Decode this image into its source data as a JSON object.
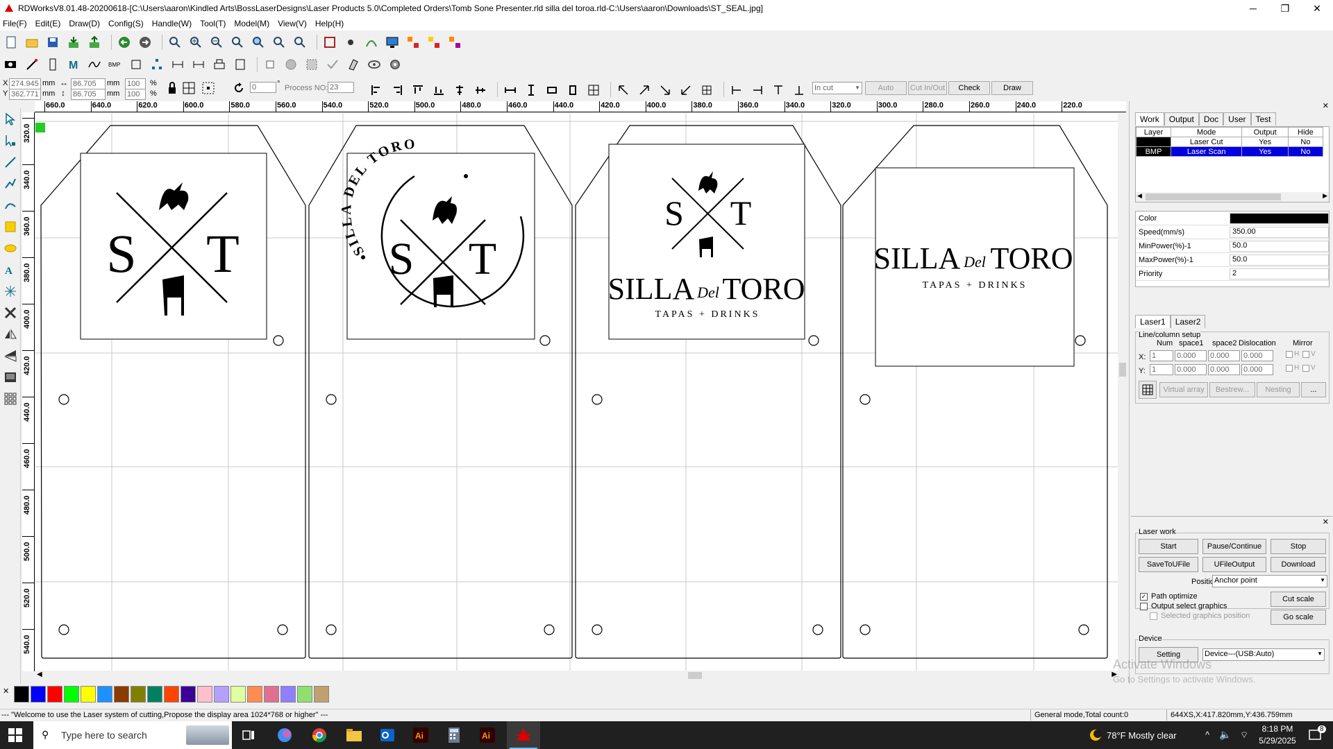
{
  "window": {
    "title": "RDWorksV8.01.48-20200618-[C:\\Users\\aaron\\Kindled Arts\\BossLaserDesigns\\Laser Products 5.0\\Completed Orders\\Tomb Sone Presenter.rld silla del toroa.rld-C:\\Users\\aaron\\Downloads\\ST_SEAL.jpg]",
    "minimize": "─",
    "restore": "❐",
    "close": "✕"
  },
  "menu": [
    "File(F)",
    "Edit(E)",
    "Draw(D)",
    "Config(S)",
    "Handle(W)",
    "Tool(T)",
    "Model(M)",
    "View(V)",
    "Help(H)"
  ],
  "coords": {
    "x_label": "X",
    "y_label": "Y",
    "x_value": "274.945",
    "y_value": "362.771",
    "x_unit": "mm",
    "y_unit": "mm",
    "w_value": "86.705",
    "h_value": "86.705",
    "w_unit": "mm",
    "h_unit": "mm",
    "sx_value": "100",
    "sy_value": "100",
    "pct": "%",
    "rot_value": "0",
    "deg": "°",
    "process_no_label": "Process NO:",
    "process_no_value": "23",
    "cut_mode": "In cut",
    "auto_label": "Auto",
    "cut_inout_label": "Cut In/Out",
    "check_label": "Check",
    "draw_label": "Draw"
  },
  "ruler_h": [
    "660.0",
    "640.0",
    "620.0",
    "600.0",
    "580.0",
    "560.0",
    "540.0",
    "520.0",
    "500.0",
    "480.0",
    "460.0",
    "440.0",
    "420.0",
    "400.0",
    "380.0",
    "360.0",
    "340.0",
    "320.0",
    "300.0",
    "280.0",
    "260.0",
    "240.0",
    "220.0"
  ],
  "ruler_v": [
    "320.0",
    "340.0",
    "360.0",
    "380.0",
    "400.0",
    "420.0",
    "440.0",
    "460.0",
    "480.0",
    "500.0",
    "520.0",
    "540.0"
  ],
  "designs": {
    "monogram_s": "S",
    "monogram_t": "T",
    "seal_text": "SILLA DEL TORO",
    "brand_left": "SILLA",
    "brand_del": "Del",
    "brand_right": "TORO",
    "tagline": "TAPAS + DRINKS"
  },
  "right_panel": {
    "tabs": [
      "Work",
      "Output",
      "Doc",
      "User",
      "Test"
    ],
    "layer_headers": [
      "Layer",
      "Mode",
      "Output",
      "Hide"
    ],
    "layers": [
      {
        "layer": "",
        "mode": "Laser Cut",
        "output": "Yes",
        "hide": "No",
        "color": "#000000"
      },
      {
        "layer": "BMP",
        "mode": "Laser Scan",
        "output": "Yes",
        "hide": "No",
        "color": "#000000"
      }
    ],
    "props": [
      {
        "k": "Color",
        "v": ""
      },
      {
        "k": "Speed(mm/s)",
        "v": "350.00"
      },
      {
        "k": "MinPower(%)-1",
        "v": "50.0"
      },
      {
        "k": "MaxPower(%)-1",
        "v": "50.0"
      },
      {
        "k": "Priority",
        "v": "2"
      }
    ],
    "laser_tabs": [
      "Laser1",
      "Laser2"
    ],
    "line_column": {
      "title": "Line/column setup",
      "headers": [
        "Num",
        "space1",
        "space2",
        "Dislocation",
        "Mirror"
      ],
      "x_label": "X:",
      "y_label": "Y:",
      "x_vals": [
        "1",
        "0.000",
        "0.000",
        "0.000"
      ],
      "y_vals": [
        "1",
        "0.000",
        "0.000",
        "0.000"
      ],
      "h": "H",
      "v": "V",
      "virtual_array": "Virtual array",
      "bestrew": "Bestrew...",
      "nesting": "Nesting",
      "more": "..."
    },
    "laser_work": {
      "title": "Laser work",
      "start": "Start",
      "pause": "Pause/Continue",
      "stop": "Stop",
      "save_u": "SaveToUFile",
      "ufile_out": "UFileOutput",
      "download": "Download",
      "position_label": "Position:",
      "position_value": "Anchor point",
      "path_optimize": "Path optimize",
      "output_select": "Output select graphics",
      "selected_pos": "Selected graphics position",
      "cut_scale": "Cut scale",
      "go_scale": "Go scale"
    },
    "device": {
      "title": "Device",
      "setting": "Setting",
      "device_value": "Device---(USB:Auto)"
    },
    "watermark1": "Activate Windows",
    "watermark2": "Go to Settings to activate Windows."
  },
  "palette": [
    "#000000",
    "#0000ff",
    "#ff0000",
    "#00ff00",
    "#ffff00",
    "#1e90ff",
    "#8b3a00",
    "#808000",
    "#008060",
    "#ff4500",
    "#3c0096",
    "#ffc0cb",
    "#b4a0ff",
    "#e0ffa0",
    "#ff8c50",
    "#e07090",
    "#9080ff",
    "#90e070",
    "#c0a070"
  ],
  "status": {
    "message": "--- \"Welcome to use the Laser system of cutting,Propose the display area 1024*768 or higher\" ---",
    "mode": "General mode,Total count:0",
    "position": "644XS,X:417.820mm,Y:436.759mm"
  },
  "taskbar": {
    "search_placeholder": "Type here to search",
    "weather": "78°F  Mostly clear",
    "time": "8:18 PM",
    "date": "5/29/2025",
    "notif_count": "8"
  }
}
